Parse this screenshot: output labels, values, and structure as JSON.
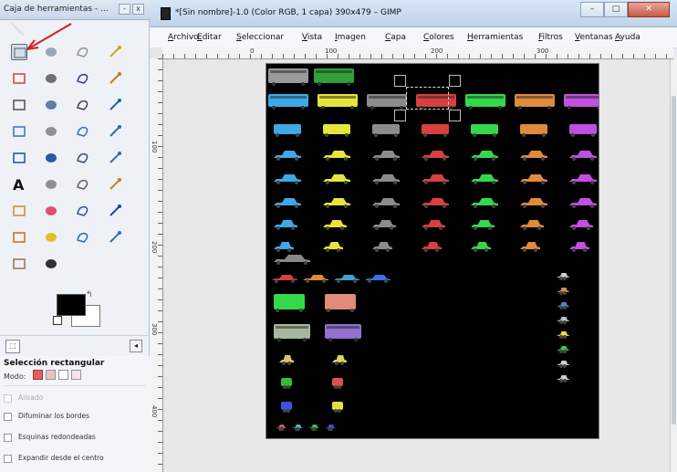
{
  "toolbox": {
    "title": "Caja de herramientas - ...",
    "minimize_glyph": "-",
    "close_glyph": "x",
    "tools": [
      {
        "name": "rect-select-icon",
        "color": "#7c8a9c",
        "selected": true
      },
      {
        "name": "ellipse-select-icon",
        "color": "#9aa6b4"
      },
      {
        "name": "free-select-icon",
        "color": "#8895a5"
      },
      {
        "name": "fuzzy-select-icon",
        "color": "#d4a020"
      },
      {
        "name": "select-by-color-icon",
        "color": "#d04040"
      },
      {
        "name": "scissors-icon",
        "color": "#707070"
      },
      {
        "name": "foreground-select-icon",
        "color": "#304080"
      },
      {
        "name": "paths-icon",
        "color": "#c07820"
      },
      {
        "name": "color-picker-icon",
        "color": "#505050"
      },
      {
        "name": "zoom-icon",
        "color": "#6080a0"
      },
      {
        "name": "measure-icon",
        "color": "#404060"
      },
      {
        "name": "move-icon",
        "color": "#2060a0"
      },
      {
        "name": "align-icon",
        "color": "#4070b0"
      },
      {
        "name": "crop-icon",
        "color": "#909090"
      },
      {
        "name": "rotate-icon",
        "color": "#3070c0"
      },
      {
        "name": "scale-icon",
        "color": "#2070b0"
      },
      {
        "name": "shear-icon",
        "color": "#2050a0"
      },
      {
        "name": "perspective-icon",
        "color": "#2858a8"
      },
      {
        "name": "flip-icon",
        "color": "#305070"
      },
      {
        "name": "cage-icon",
        "color": "#3a6aa0"
      },
      {
        "name": "text-icon",
        "color": "#111111"
      },
      {
        "name": "bucket-fill-icon",
        "color": "#909090"
      },
      {
        "name": "blend-icon",
        "color": "#606060"
      },
      {
        "name": "pencil-icon",
        "color": "#c08020"
      },
      {
        "name": "paintbrush-icon",
        "color": "#c09030"
      },
      {
        "name": "eraser-icon",
        "color": "#e05070"
      },
      {
        "name": "airbrush-icon",
        "color": "#3050a0"
      },
      {
        "name": "ink-icon",
        "color": "#2040a0"
      },
      {
        "name": "clone-icon",
        "color": "#c07010"
      },
      {
        "name": "heal-icon",
        "color": "#e0c020"
      },
      {
        "name": "perspective-clone-icon",
        "color": "#2a6aa0"
      },
      {
        "name": "blur-icon",
        "color": "#3070b0"
      },
      {
        "name": "smudge-icon",
        "color": "#a07040"
      },
      {
        "name": "dodge-burn-icon",
        "color": "#303030"
      }
    ],
    "swap_glyph": "↰",
    "tab_glyph": "⬚",
    "tab_menu_glyph": "◂",
    "options": {
      "title": "Selección rectangular",
      "mode_label": "Modo:",
      "antialias": "Alisado",
      "feather": "Difuminar los bordes",
      "rounded": "Esquinas redondeadas",
      "expand_center": "Expandir desde el centro"
    }
  },
  "image_window": {
    "title": "*[Sin nombre]-1.0 (Color RGB, 1 capa) 390x479 – GIMP",
    "controls": {
      "min": "–",
      "max": "□",
      "close": "✕"
    },
    "menus": [
      {
        "u": "A",
        "rest": "rchivo"
      },
      {
        "u": "E",
        "rest": "ditar"
      },
      {
        "u": "S",
        "rest": "eleccionar"
      },
      {
        "u": "V",
        "rest": "ista"
      },
      {
        "u": "I",
        "rest": "magen"
      },
      {
        "u": "C",
        "rest": "apa"
      },
      {
        "u": "C",
        "rest": "olores"
      },
      {
        "u": "H",
        "rest": "erramientas"
      },
      {
        "u": "F",
        "rest": "iltros"
      },
      {
        "u": "V",
        "rest": "entanas"
      },
      {
        "u": "A",
        "rest": "yuda"
      }
    ],
    "ruler_h_labels": [
      "0",
      "100",
      "200",
      "300"
    ],
    "ruler_v_labels": [
      "100",
      "200",
      "300",
      "400"
    ]
  }
}
